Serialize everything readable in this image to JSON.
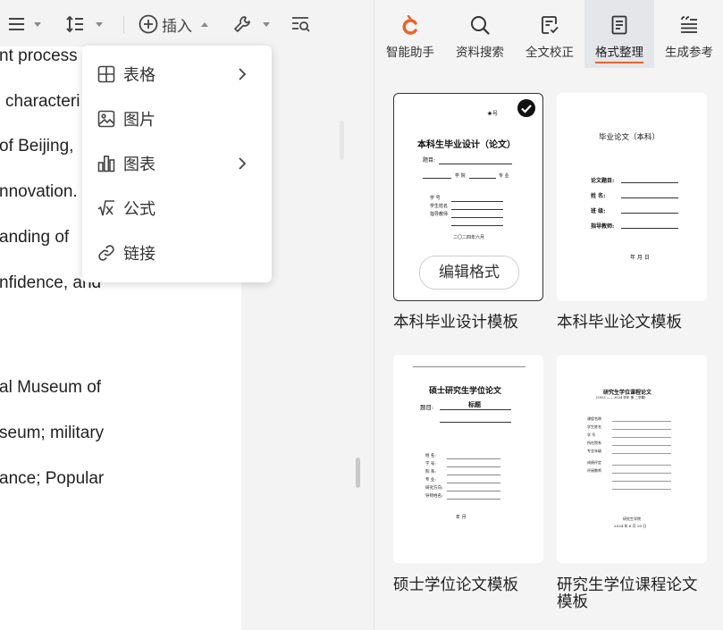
{
  "toolbar": {
    "insert_label": "插入"
  },
  "document_lines": [
    "nt process",
    "characteri",
    "of  Beijing,",
    "nnovation.",
    "anding  of",
    "nfidence,  and",
    "al  Museum  of",
    "seum; military",
    "ance; Popular"
  ],
  "insert_menu": {
    "items": [
      {
        "label": "表格",
        "icon": "table-icon",
        "submenu": true
      },
      {
        "label": "图片",
        "icon": "image-icon",
        "submenu": false
      },
      {
        "label": "图表",
        "icon": "bar-chart-icon",
        "submenu": true
      },
      {
        "label": "公式",
        "icon": "formula-icon",
        "submenu": false
      },
      {
        "label": "链接",
        "icon": "link-icon",
        "submenu": false
      }
    ]
  },
  "side_tabs": [
    {
      "label": "智能助手",
      "icon": "assistant-logo-icon",
      "active": false
    },
    {
      "label": "资料搜索",
      "icon": "search-icon",
      "active": false
    },
    {
      "label": "全文校正",
      "icon": "proofread-icon",
      "active": false
    },
    {
      "label": "格式整理",
      "icon": "format-doc-icon",
      "active": true
    },
    {
      "label": "生成参考",
      "icon": "reference-icon",
      "active": false
    }
  ],
  "templates": [
    {
      "caption": "本科毕业设计模板",
      "selected": true,
      "edit_button": "编辑格式",
      "preview": {
        "corner": "★号",
        "title": "本科生毕业设计（论文）",
        "topic": "题目:",
        "row2_a": "学 院",
        "row2_b": "专 业",
        "f1": "学  号",
        "f2": "学生姓名",
        "f3": "指导教师",
        "date": "二〇二四年六月"
      }
    },
    {
      "caption": "本科毕业论文模板",
      "selected": false,
      "preview": {
        "title": "毕业论文（本科）",
        "f1": "论文题目:",
        "f2": "姓    名:",
        "f3": "班    级:",
        "f4": "指导教师:",
        "date": "年    月    日"
      }
    },
    {
      "caption": "硕士学位论文模板",
      "selected": false,
      "preview": {
        "title": "硕士研究生学位论文",
        "topic_label": "题目:",
        "topic_value": "标题",
        "f1": "姓    名:",
        "f2": "学    号:",
        "f3": "院    系:",
        "f4": "专    业:",
        "f5": "研究方向:",
        "f6": "导师姓名:",
        "date": "年    月"
      }
    },
    {
      "caption": "研究生学位课程论文模板",
      "selected": false,
      "preview": {
        "title": "研究生学位课程论文",
        "subtitle": "(2023 —— 2024 学年 第 二学期)",
        "f1": "课程名称",
        "f2": "学生姓名",
        "f3": "学    号",
        "f4": "所在院系",
        "f5": "专业年级",
        "f6": "成绩评定",
        "f7": "评阅教师",
        "org": "研究生学院",
        "date": "2024 年 6 月 28 日"
      }
    }
  ]
}
